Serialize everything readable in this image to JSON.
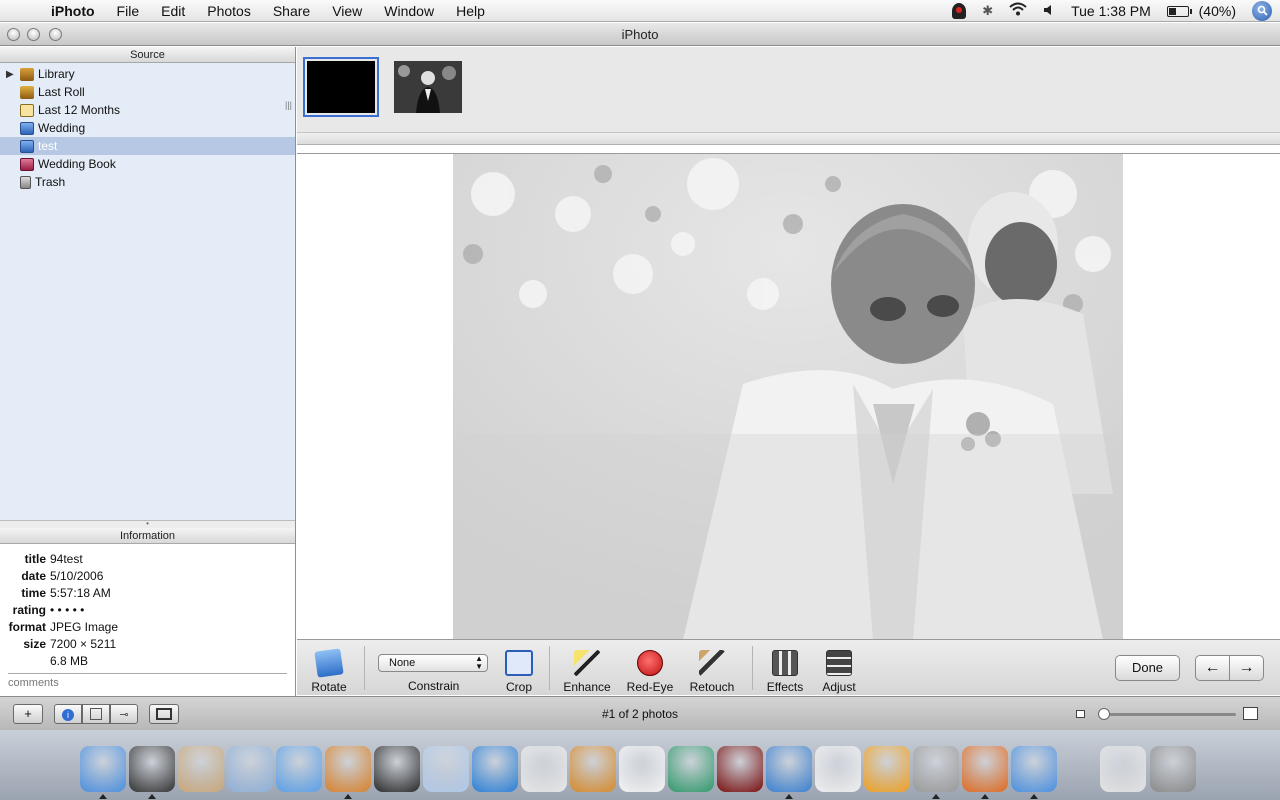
{
  "menubar": {
    "apple": "",
    "items": [
      {
        "label": "iPhoto"
      },
      {
        "label": "File"
      },
      {
        "label": "Edit"
      },
      {
        "label": "Photos"
      },
      {
        "label": "Share"
      },
      {
        "label": "View"
      },
      {
        "label": "Window"
      },
      {
        "label": "Help"
      }
    ],
    "clock": "Tue 1:38 PM",
    "battery": "(40%)",
    "battery_level": 0.4,
    "status_icons": [
      "bluetooth-icon",
      "wifi-icon",
      "volume-icon"
    ]
  },
  "window": {
    "title": "iPhoto"
  },
  "source": {
    "header": "Source",
    "items": [
      {
        "label": "Library",
        "icon": "library-icon"
      },
      {
        "label": "Last Roll",
        "icon": "roll-icon"
      },
      {
        "label": "Last 12 Months",
        "icon": "calendar-icon"
      },
      {
        "label": "Wedding",
        "icon": "album-icon"
      },
      {
        "label": "test",
        "icon": "album-icon"
      },
      {
        "label": "Wedding Book",
        "icon": "book-icon"
      },
      {
        "label": "Trash",
        "icon": "trash-icon"
      }
    ],
    "selected_index": 4
  },
  "information": {
    "header": "Information",
    "rows": [
      {
        "key": "title",
        "value": "94test"
      },
      {
        "key": "date",
        "value": "5/10/2006"
      },
      {
        "key": "time",
        "value": "5:57:18 AM"
      },
      {
        "key": "rating",
        "value": "• • • • •"
      },
      {
        "key": "format",
        "value": "JPEG Image"
      },
      {
        "key": "size",
        "value": "7200 × 5211"
      },
      {
        "key": "",
        "value": "6.8 MB"
      }
    ],
    "comments_placeholder": "comments"
  },
  "edit_toolbar": {
    "rotate": "Rotate",
    "constrain_value": "None",
    "constrain": "Constrain",
    "crop": "Crop",
    "enhance": "Enhance",
    "redeye": "Red-Eye",
    "retouch": "Retouch",
    "effects": "Effects",
    "adjust": "Adjust",
    "done": "Done",
    "prev": "←",
    "next": "→"
  },
  "bottom": {
    "add": "+",
    "photo_count": "#1 of 2 photos",
    "zoom_level": 0
  },
  "dock": {
    "icons": [
      "finder-icon",
      "dashboard-icon",
      "address-book-icon",
      "mail-icon",
      "itunes-icon",
      "iphoto-icon",
      "imovie-icon",
      "preview-icon",
      "dvd-player-icon",
      "iweb-icon",
      "garageband-icon",
      "ical-icon",
      "ichat-icon",
      "front-row-icon",
      "safari-icon",
      "textedit-icon",
      "money-icon",
      "calculator-icon",
      "firefox-icon",
      "sync-icon",
      "document-icon",
      "trash-icon"
    ]
  },
  "colors": {
    "source_bg": "#e4ecf7",
    "selection": "#b6c8e3",
    "thumb_outline": "#3b6fd2"
  }
}
